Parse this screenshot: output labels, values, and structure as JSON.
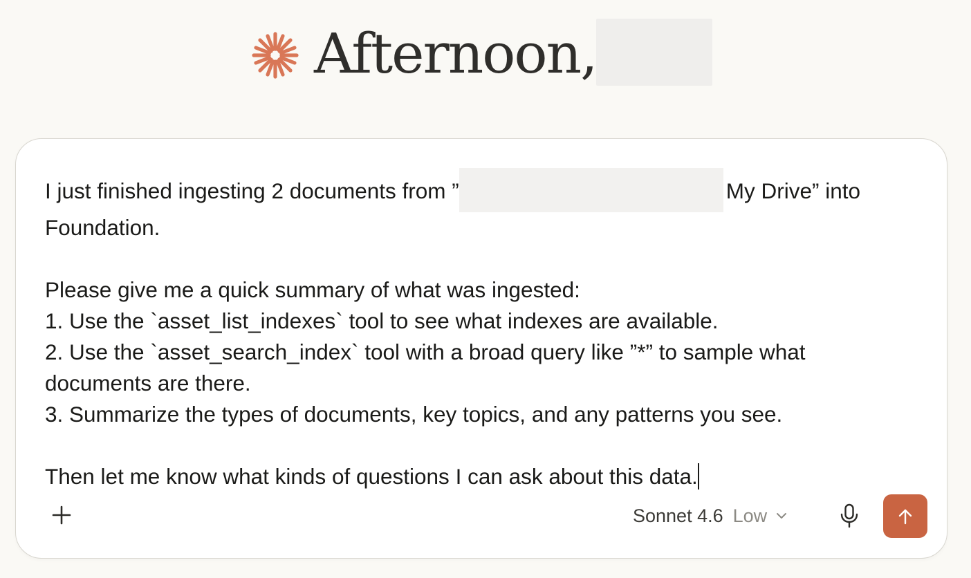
{
  "greeting": {
    "text": "Afternoon,",
    "icon": "spark-icon",
    "accent_color": "#d97757"
  },
  "composer": {
    "prompt": {
      "line1_before": "I just finished ingesting 2 documents from ”",
      "line1_after": "My Drive” into Foundation.",
      "line2": "Please give me a quick summary of what was ingested:",
      "line3": "1. Use the `asset_list_indexes` tool to see what indexes are available.",
      "line4": "2. Use the `asset_search_index` tool with a broad query like ”*” to sample what documents are there.",
      "line5": "3. Summarize the types of documents, key topics, and any patterns you see.",
      "line6": "Then let me know what kinds of questions I can ask about this data."
    }
  },
  "toolbar": {
    "add_icon": "plus-icon",
    "model_name": "Sonnet 4.6",
    "effort_label": "Low",
    "chevron_icon": "chevron-down-icon",
    "mic_icon": "microphone-icon",
    "send_icon": "arrow-up-icon",
    "send_color": "#c96442"
  }
}
